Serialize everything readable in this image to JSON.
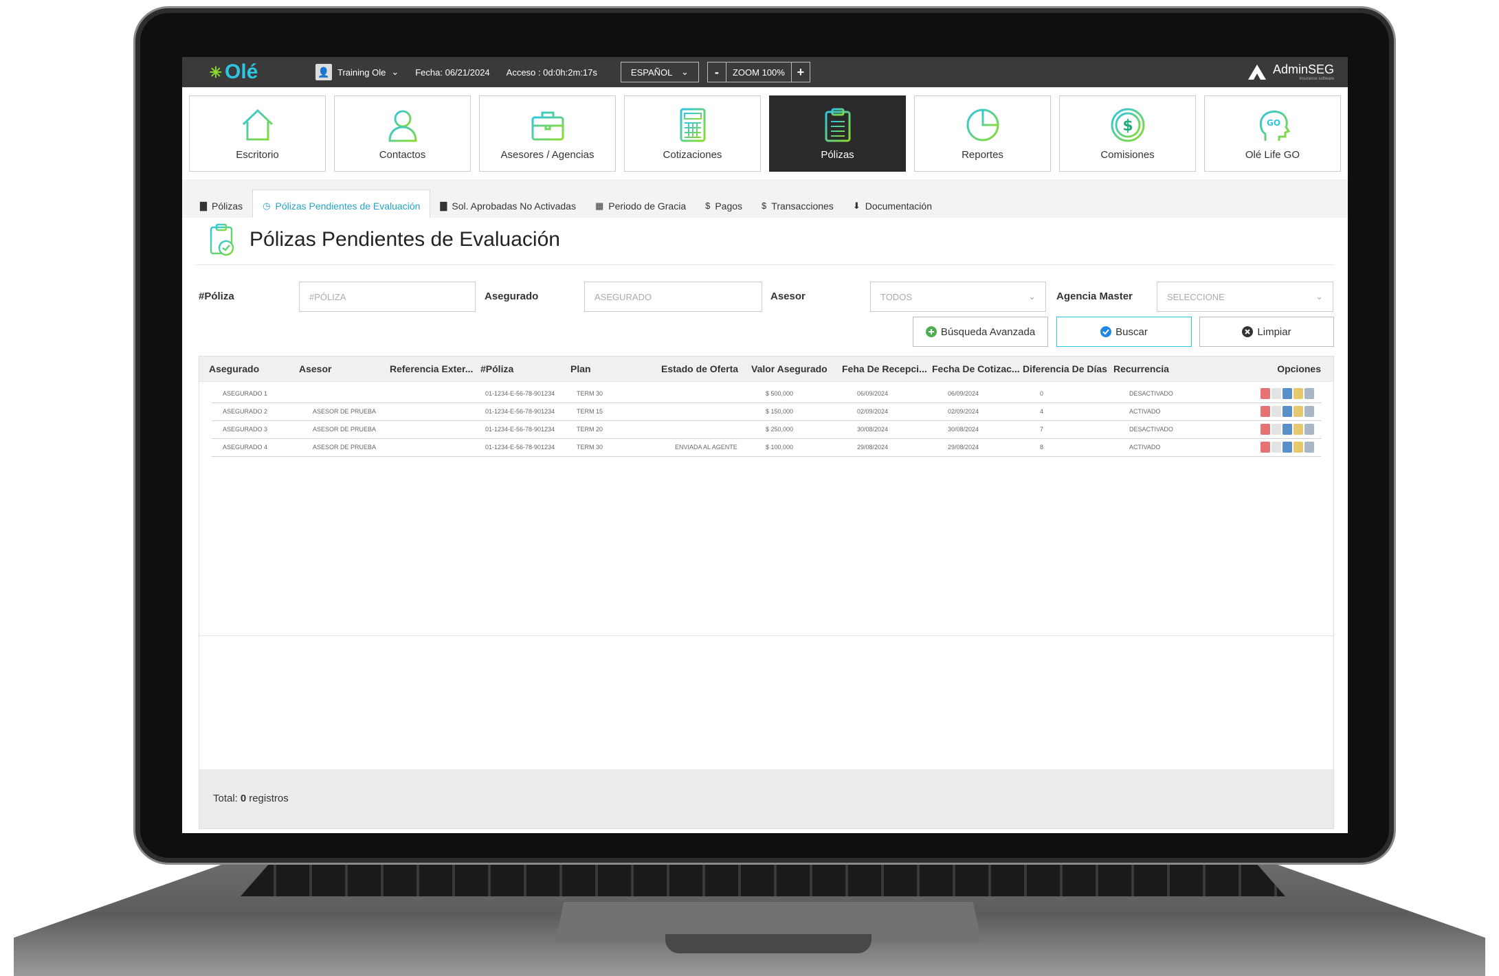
{
  "topbar": {
    "logo": "Olé",
    "user": "Training Ole",
    "date": "Fecha: 06/21/2024",
    "access": "Acceso : 0d:0h:2m:17s",
    "language": "ESPAÑOL",
    "zoom_minus": "-",
    "zoom": "ZOOM 100%",
    "zoom_plus": "+",
    "brand": "AdminSEG",
    "brand_sub": "Insurance software"
  },
  "modules": [
    {
      "label": "Escritorio",
      "icon": "home-icon"
    },
    {
      "label": "Contactos",
      "icon": "user-icon"
    },
    {
      "label": "Asesores / Agencias",
      "icon": "briefcase-icon"
    },
    {
      "label": "Cotizaciones",
      "icon": "calculator-icon"
    },
    {
      "label": "Pólizas",
      "icon": "clipboard-icon",
      "active": true
    },
    {
      "label": "Reportes",
      "icon": "pie-chart-icon"
    },
    {
      "label": "Comisiones",
      "icon": "dollar-coin-icon"
    },
    {
      "label": "Olé Life GO",
      "icon": "head-go-icon"
    }
  ],
  "tabs": [
    {
      "label": "Pólizas",
      "icon": "document-icon"
    },
    {
      "label": "Pólizas Pendientes de Evaluación",
      "icon": "clock-icon",
      "active": true
    },
    {
      "label": "Sol. Aprobadas No Activadas",
      "icon": "document-icon"
    },
    {
      "label": "Periodo de Gracia",
      "icon": "calendar-icon"
    },
    {
      "label": "Pagos",
      "icon": "dollar-icon"
    },
    {
      "label": "Transacciones",
      "icon": "dollar-icon"
    },
    {
      "label": "Documentación",
      "icon": "download-icon"
    }
  ],
  "page": {
    "title": "Pólizas Pendientes de Evaluación"
  },
  "filters": {
    "poliza_label": "#Póliza",
    "poliza_placeholder": "#PÓLIZA",
    "asegurado_label": "Asegurado",
    "asegurado_placeholder": "ASEGURADO",
    "asesor_label": "Asesor",
    "asesor_value": "TODOS",
    "agencia_label": "Agencia Master",
    "agencia_value": "SELECCIONE"
  },
  "buttons": {
    "advanced": "Búsqueda Avanzada",
    "search": "Buscar",
    "clear": "Limpiar"
  },
  "table": {
    "columns": [
      "Asegurado",
      "Asesor",
      "Referencia Exter...",
      "#Póliza",
      "Plan",
      "Estado de Oferta",
      "Valor Asegurado",
      "Feha De Recepci...",
      "Fecha De Cotizac...",
      "Diferencia De Días",
      "Recurrencia",
      "Opciones"
    ],
    "rows": [
      {
        "asegurado": "ASEGURADO 1",
        "asesor": "",
        "referencia": "",
        "poliza": "01-1234-E-56-78-901234",
        "plan": "TERM 30",
        "estado": "",
        "valor": "$ 500,000",
        "recepcion": "06/09/2024",
        "cotizacion": "06/09/2024",
        "diferencia": "0",
        "recurrencia": "DESACTIVADO"
      },
      {
        "asegurado": "ASEGURADO 2",
        "asesor": "ASESOR DE PRUEBA",
        "referencia": "",
        "poliza": "01-1234-E-56-78-901234",
        "plan": "TERM 15",
        "estado": "",
        "valor": "$ 150,000",
        "recepcion": "02/09/2024",
        "cotizacion": "02/09/2024",
        "diferencia": "4",
        "recurrencia": "ACTIVADO"
      },
      {
        "asegurado": "ASEGURADO 3",
        "asesor": "ASESOR DE PRUEBA",
        "referencia": "",
        "poliza": "01-1234-E-56-78-901234",
        "plan": "TERM 20",
        "estado": "",
        "valor": "$ 250,000",
        "recepcion": "30/08/2024",
        "cotizacion": "30/08/2024",
        "diferencia": "7",
        "recurrencia": "DESACTIVADO"
      },
      {
        "asegurado": "ASEGURADO 4",
        "asesor": "ASESOR DE PRUEBA",
        "referencia": "",
        "poliza": "01-1234-E-56-78-901234",
        "plan": "TERM 30",
        "estado": "ENVIADA AL AGENTE",
        "valor": "$ 100,000",
        "recepcion": "29/08/2024",
        "cotizacion": "29/08/2024",
        "diferencia": "8",
        "recurrencia": "ACTIVADO"
      }
    ],
    "option_icons": [
      "pdf-icon",
      "document-share-icon",
      "cards-icon",
      "edit-icon",
      "trash-icon"
    ]
  },
  "footer": {
    "total_label": "Total:",
    "total_count": "0",
    "total_suffix": "registros"
  },
  "colors": {
    "accent": "#2ec5e3",
    "green": "#8bdc2e",
    "topbar": "#3a3a3a",
    "active_module": "#2a2a2a"
  }
}
